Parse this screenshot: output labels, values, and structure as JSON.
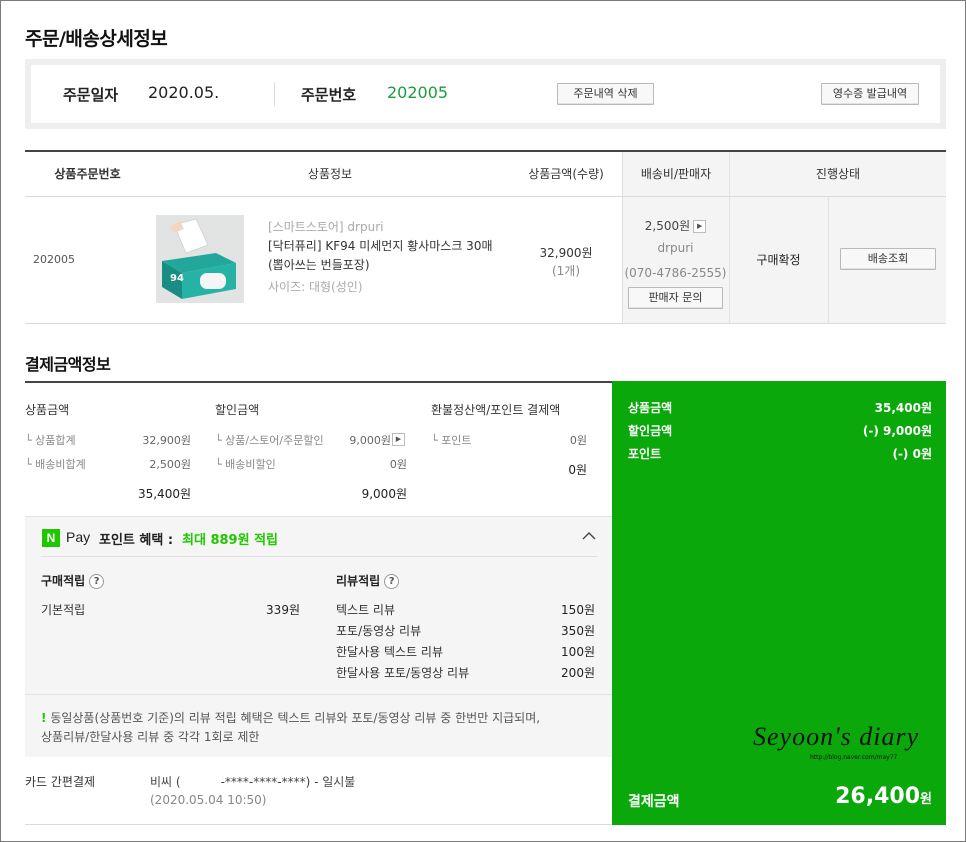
{
  "page_title": "주문/배송상세정보",
  "order_header": {
    "date_label": "주문일자",
    "date_value": "2020.05.",
    "number_label": "주문번호",
    "number_value": "202005",
    "delete_button": "주문내역 삭제",
    "receipt_button": "영수증 발급내역"
  },
  "product_table": {
    "columns": [
      "상품주문번호",
      "상품정보",
      "상품금액(수량)",
      "배송비/판매자",
      "진행상태"
    ],
    "row": {
      "order_number": "202005",
      "store": "[스마트스토어] drpuri",
      "name": "[닥터퓨리] KF94 미세먼지 황사마스크 30매 (뽑아쓰는 번들포장)",
      "size": "사이즈: 대형(성인)",
      "price": "32,900원",
      "quantity": "(1개)",
      "shipping_fee": "2,500원",
      "seller": "drpuri",
      "seller_phone": "(070-4786-2555)",
      "seller_inquiry_button": "판매자 문의",
      "status": "구매확정",
      "track_button": "배송조회",
      "thumb_text": "94"
    }
  },
  "payment": {
    "section_title": "결제금액정보",
    "product_amount": {
      "title": "상품금액",
      "items": [
        {
          "label": "└ 상품합계",
          "value": "32,900원"
        },
        {
          "label": "└ 배송비합계",
          "value": "2,500원"
        }
      ],
      "total": "35,400원"
    },
    "discount_amount": {
      "title": "할인금액",
      "items": [
        {
          "label": "└ 상품/스토어/주문할인",
          "value": "9,000원"
        },
        {
          "label": "└ 배송비할인",
          "value": "0원"
        }
      ],
      "total": "9,000원"
    },
    "refund_amount": {
      "title": "환불정산액/포인트 결제액",
      "items": [
        {
          "label": "└ 포인트",
          "value": "0원"
        }
      ],
      "total": "0원"
    },
    "summary": {
      "product_label": "상품금액",
      "product_value": "35,400원",
      "discount_label": "할인금액",
      "discount_value": "(-) 9,000원",
      "point_label": "포인트",
      "point_value": "(-) 0원",
      "final_label": "결제금액",
      "final_value": "26,400",
      "final_unit": "원"
    },
    "npay": {
      "badge": "N",
      "pay_text": "Pay",
      "benefit_label": "포인트 혜택 :",
      "benefit_value": "최대 889원 적립",
      "purchase_title": "구매적립",
      "purchase_items": [
        {
          "label": "기본적립",
          "value": "339원"
        }
      ],
      "review_title": "리뷰적립",
      "review_items": [
        {
          "label": "텍스트 리뷰",
          "value": "150원"
        },
        {
          "label": "포토/동영상 리뷰",
          "value": "350원"
        },
        {
          "label": "한달사용 텍스트 리뷰",
          "value": "100원"
        },
        {
          "label": "한달사용 포토/동영상 리뷰",
          "value": "200원"
        }
      ],
      "notice_mark": "!",
      "notice_line1": "동일상품(상품번호 기준)의 리뷰 적립 혜택은 텍스트 리뷰와 포토/동영상 리뷰 중 한번만 지급되며,",
      "notice_line2": "상품리뷰/한달사용 리뷰 중 각각 1회로 제한"
    },
    "method": {
      "label": "카드 간편결제",
      "card": "비씨 (",
      "card_masked": "-****-****-****) - 일시불",
      "datetime": "(2020.05.04 10:50)"
    }
  },
  "watermark": {
    "title": "Seyoon's diary",
    "url": "http://blog.naver.com/may77"
  },
  "colors": {
    "accent_green": "#0aa80a",
    "order_number_green": "#1a9e3a",
    "npay_green": "#1ec800"
  }
}
